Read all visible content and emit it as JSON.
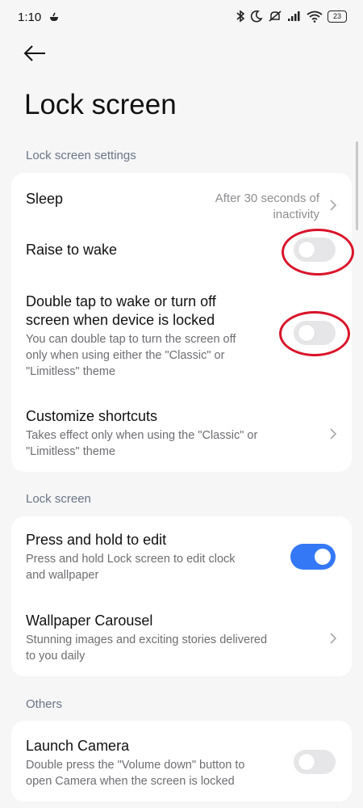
{
  "status_bar": {
    "time": "1:10",
    "battery": "23",
    "icons": [
      "app-notification-icon",
      "bluetooth-icon",
      "moon-icon",
      "mute-icon",
      "signal-icon",
      "wifi-icon",
      "battery-icon"
    ]
  },
  "header": {
    "back_icon": "arrow-left-icon",
    "title": "Lock screen"
  },
  "sections": {
    "lock_screen_settings": {
      "header": "Lock screen settings",
      "sleep": {
        "title": "Sleep",
        "value_line1": "After 30 seconds of",
        "value_line2": "inactivity"
      },
      "raise_to_wake": {
        "title": "Raise to wake",
        "enabled": false
      },
      "double_tap": {
        "title_line1": "Double tap to wake or turn off",
        "title_line2": "screen when device is locked",
        "sub_line1": "You can double tap to turn the screen off",
        "sub_line2": "only when using either the \"Classic\" or",
        "sub_line3": "\"Limitless\" theme",
        "enabled": false
      },
      "customize_shortcuts": {
        "title": "Customize shortcuts",
        "sub_line1": "Takes effect only when using the \"Classic\" or",
        "sub_line2": "\"Limitless\" theme"
      }
    },
    "lock_screen": {
      "header": "Lock screen",
      "press_hold": {
        "title": "Press and hold to edit",
        "sub_line1": "Press and hold Lock screen to edit clock",
        "sub_line2": "and wallpaper",
        "enabled": true
      },
      "wallpaper_carousel": {
        "title": "Wallpaper Carousel",
        "sub_line1": "Stunning images and exciting stories delivered",
        "sub_line2": "to you daily"
      }
    },
    "others": {
      "header": "Others",
      "launch_camera": {
        "title": "Launch Camera",
        "sub_line1": "Double press the \"Volume down\" button to",
        "sub_line2": "open Camera when the screen is locked",
        "enabled": false
      }
    }
  },
  "colors": {
    "background": "#f6f6f7",
    "card": "#ffffff",
    "accent": "#3478f6",
    "section_header": "#6b7485",
    "annotation": "#d9142a"
  }
}
